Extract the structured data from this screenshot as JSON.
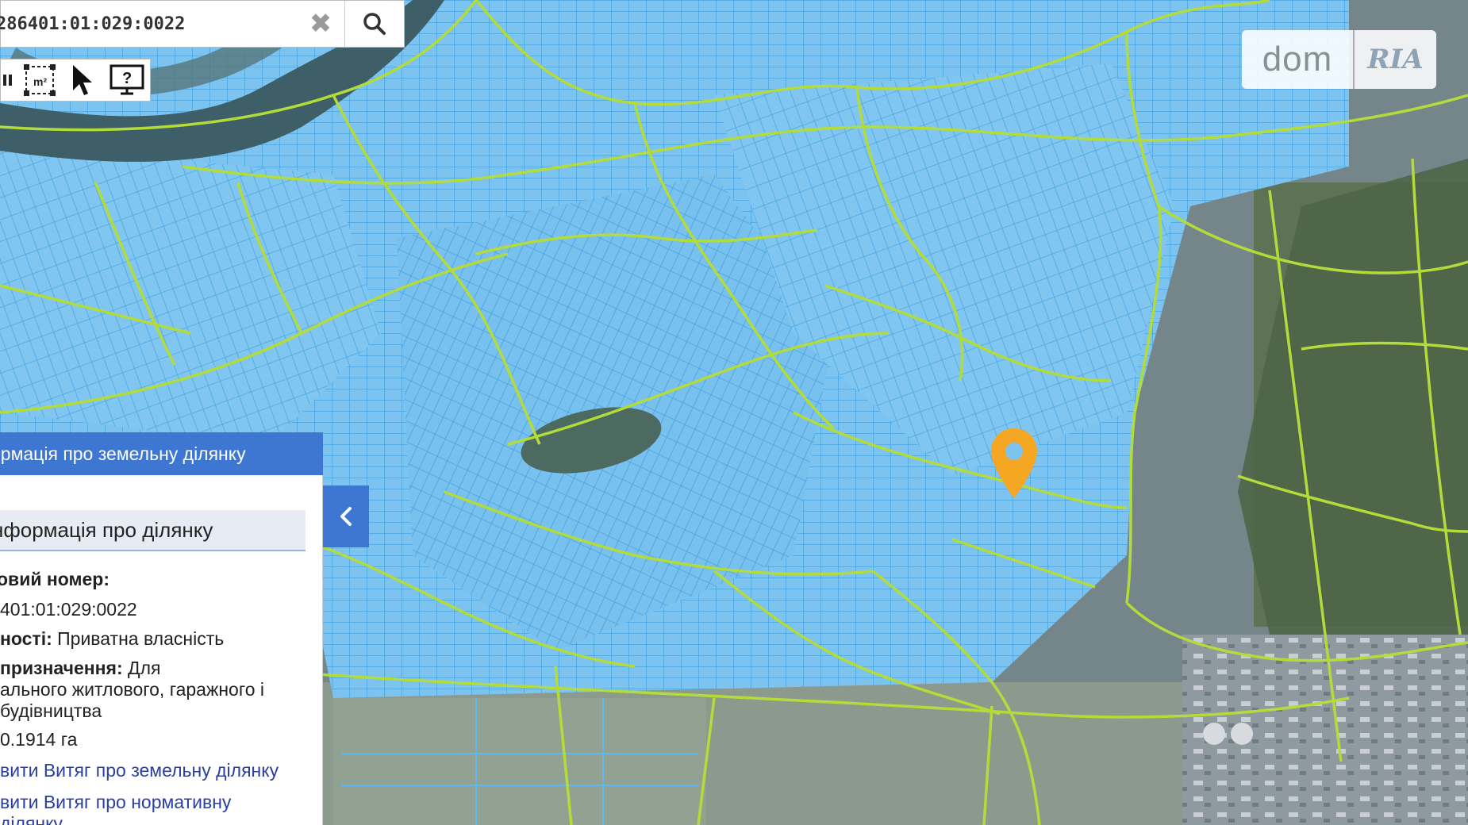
{
  "search": {
    "value": "286401:01:029:0022",
    "clear_icon": "close-icon",
    "search_icon": "search-icon"
  },
  "toolbar": {
    "tools": [
      "pan-icon",
      "area-measure-icon",
      "select-pointer-icon",
      "help-monitor-icon"
    ],
    "area_label": "m²"
  },
  "logo": {
    "dom": "dom",
    "ria": "RIA"
  },
  "panel": {
    "header": "ормація про земельну ділянку",
    "section_title": "нформація про ділянку",
    "cadastral_label": "овий номер:",
    "cadastral_value": "401:01:029:0022",
    "ownership_label": "ності:",
    "ownership_value": "Приватна власність",
    "purpose_label": "призначення:",
    "purpose_value_1": "Для",
    "purpose_value_2": "ального житлового, гаражного і",
    "purpose_value_3": "будівництва",
    "area_value": "0.1914 га",
    "link_1": "вити Витяг про земельну ділянку",
    "link_2": "вити Витяг про нормативну",
    "link_3": "ділянку"
  },
  "colors": {
    "accent_blue": "#3d77d2",
    "parcel_blue": "#5fb8f0",
    "boundary_green": "#b3dc3a",
    "marker_orange": "#f5a623",
    "link_color": "#2a3f9e"
  }
}
